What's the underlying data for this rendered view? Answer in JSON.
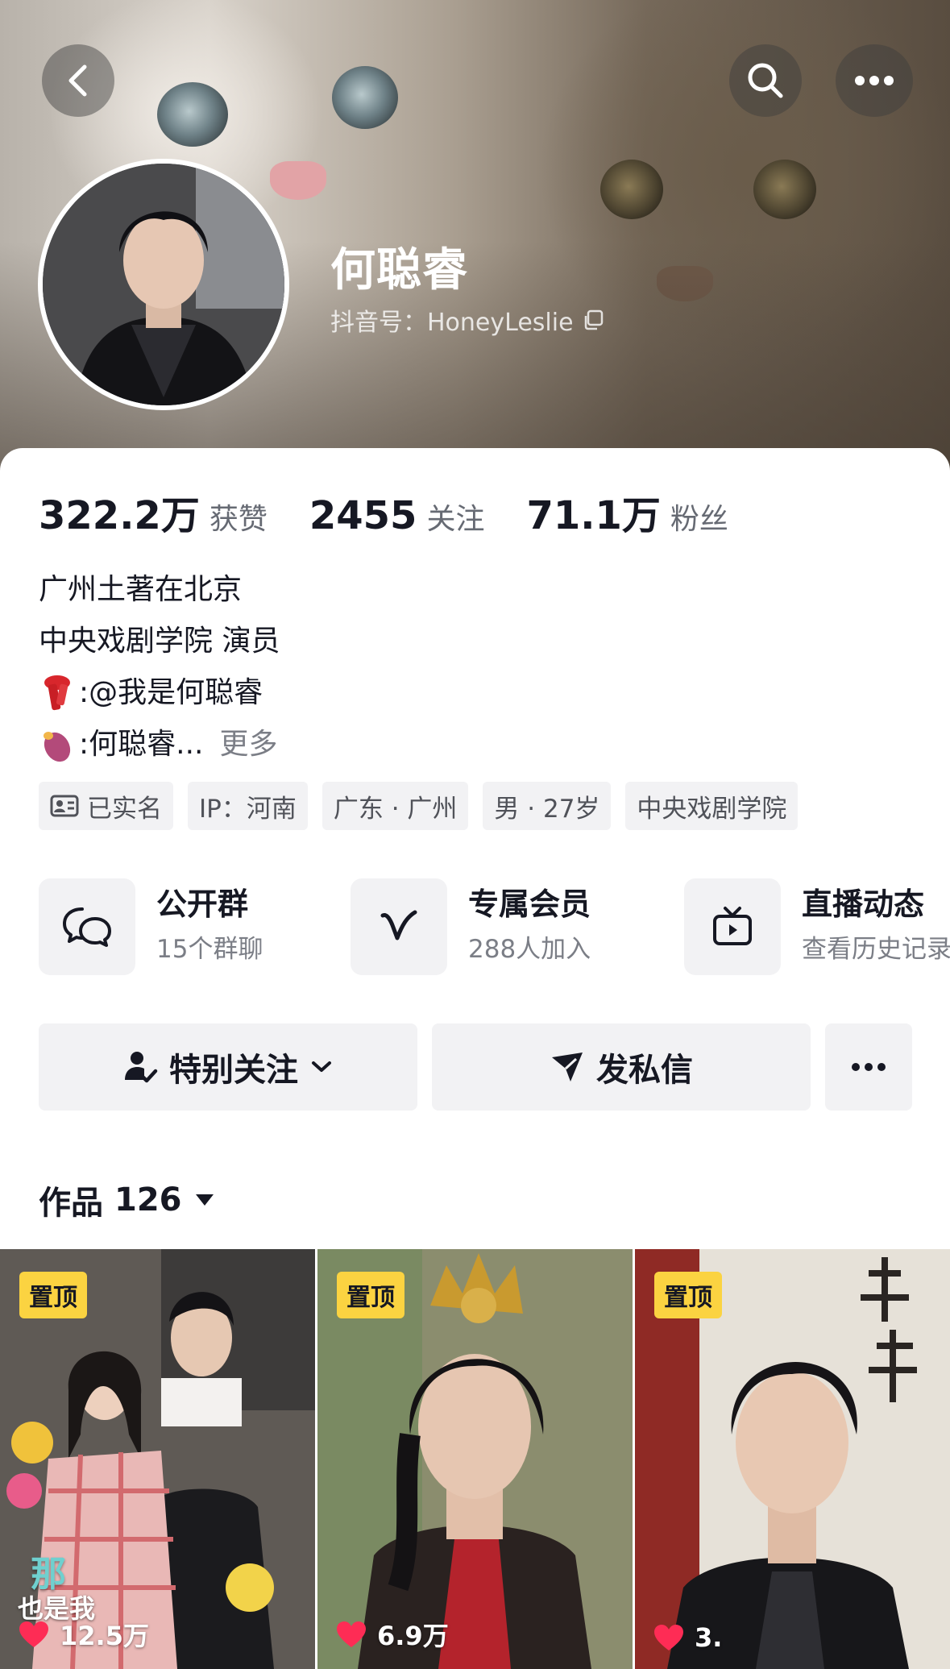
{
  "profile": {
    "name": "何聪睿",
    "douyin_id": "抖音号：HoneyLeslie"
  },
  "stats": [
    {
      "value": "322.2万",
      "label": "获赞"
    },
    {
      "value": "2455",
      "label": "关注"
    },
    {
      "value": "71.1万",
      "label": "粉丝"
    }
  ],
  "bio": {
    "line1": "广州土著在北京",
    "line2": "中央戏剧学院 演员",
    "line3": ":@我是何聪睿",
    "line4": ":何聪睿...",
    "more": "更多"
  },
  "tags": [
    {
      "label": "已实名"
    },
    {
      "label": "IP：河南"
    },
    {
      "label": "广东 · 广州"
    },
    {
      "label": "男 · 27岁"
    },
    {
      "label": "中央戏剧学院"
    }
  ],
  "features": [
    {
      "title": "公开群",
      "sub": "15个群聊"
    },
    {
      "title": "专属会员",
      "sub": "288人加入"
    },
    {
      "title": "直播动态",
      "sub": "查看历史记录"
    }
  ],
  "actions": {
    "follow": "特别关注",
    "message": "发私信"
  },
  "works": {
    "label": "作品",
    "count": "126"
  },
  "videos": [
    {
      "pin": "置顶",
      "likes": "12.5万",
      "overlay": "那",
      "overlay2": "也是我"
    },
    {
      "pin": "置顶",
      "likes": "6.9万"
    },
    {
      "pin": "置顶",
      "likes": "3."
    }
  ],
  "colors": {
    "pin_badge": "#fbd341",
    "like_heart": "#fe2c55",
    "chip_bg": "#f2f2f4"
  }
}
